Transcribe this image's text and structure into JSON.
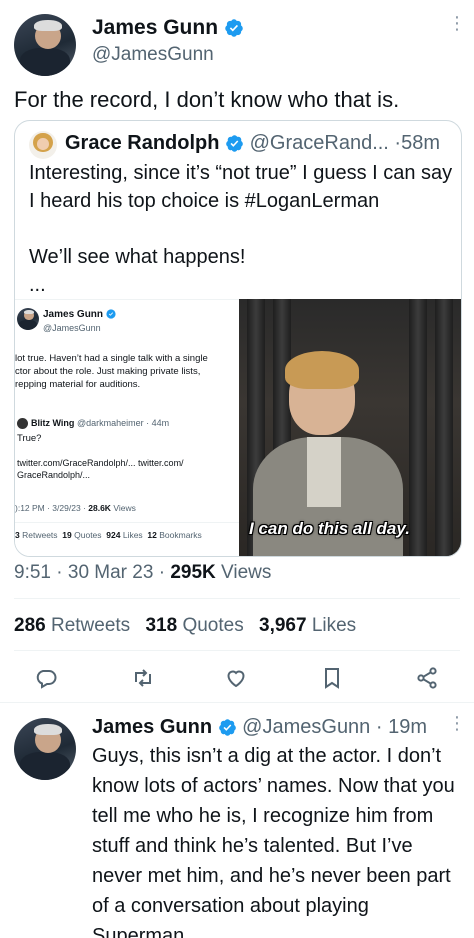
{
  "main_tweet": {
    "author_name": "James Gunn",
    "author_handle": "@JamesGunn",
    "text": "For the record, I don’t know who that is.",
    "timestamp_time": "9:51",
    "timestamp_date": "30 Mar 23",
    "views_count": "295K",
    "views_label": "Views",
    "retweets_count": "286",
    "retweets_label": "Retweets",
    "quotes_count": "318",
    "quotes_label": "Quotes",
    "likes_count": "3,967",
    "likes_label": "Likes",
    "separator": "·",
    "more_glyph": "⋮"
  },
  "quoted_tweet": {
    "author_name": "Grace Randolph",
    "author_handle": "@GraceRand...",
    "time": "58m",
    "separator": "·",
    "text_line1": "Interesting, since it’s “not true” I guess I can say I heard his top choice is #LoganLerman",
    "text_line2": "We’ll see what happens!",
    "text_line3": "...",
    "embedded_screenshot": {
      "author_name": "James Gunn",
      "author_handle": "@JamesGunn",
      "text_lines": [
        "lot true. Haven’t had a single talk with a single",
        "ctor about the role. Just making private lists,",
        "repping material for auditions."
      ],
      "reply_name": "Blitz Wing",
      "reply_handle": "@darkmaheimer · 44m",
      "reply_text": "True?",
      "links_line1": "twitter.com/GraceRandolph/... twitter.com/",
      "links_line2": "GraceRandolph/...",
      "meta_time": "):12 PM · 3/29/23 ·",
      "meta_views_count": "28.6K",
      "meta_views_label": "Views",
      "stats_retweets_count": "3",
      "stats_retweets_label": "Retweets",
      "stats_quotes_count": "19",
      "stats_quotes_label": "Quotes",
      "stats_likes_count": "924",
      "stats_likes_label": "Likes",
      "stats_bookmarks_count": "12",
      "stats_bookmarks_label": "Bookmarks"
    },
    "meme_caption": "I can do this all day."
  },
  "actions": [
    {
      "name": "reply-icon"
    },
    {
      "name": "retweet-icon"
    },
    {
      "name": "like-icon"
    },
    {
      "name": "bookmark-icon"
    },
    {
      "name": "share-icon"
    }
  ],
  "reply_tweet": {
    "author_name": "James Gunn",
    "author_handle": "@JamesGunn",
    "separator": "·",
    "time": "19m",
    "text": "Guys, this isn’t a dig at the actor. I don’t know lots of actors’ names. Now that you tell me who he is, I recognize him from stuff and think he’s talented. But I’ve never met him, and he’s never been part of a conversation about playing Superman.",
    "more_glyph": "⋮"
  },
  "colors": {
    "verified_blue": "#1d9bf0",
    "secondary_text": "#536471",
    "primary_text": "#0f1419",
    "border": "#cfd9de"
  }
}
